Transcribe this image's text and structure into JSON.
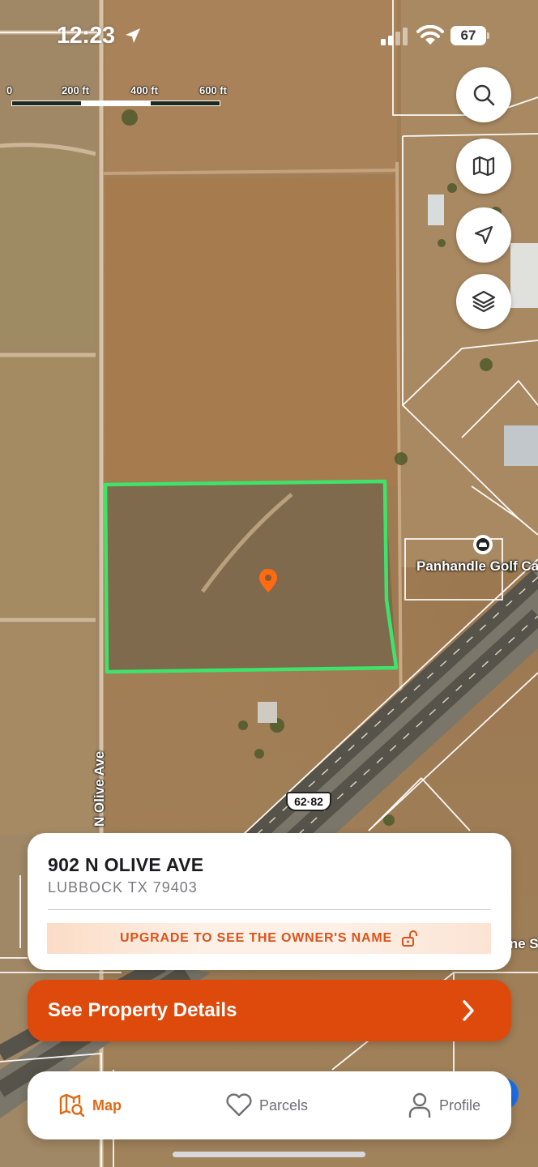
{
  "status_bar": {
    "time": "12:23",
    "battery": "67"
  },
  "scale": {
    "labels": [
      "0",
      "200 ft",
      "400 ft",
      "600 ft"
    ]
  },
  "map": {
    "road_label": "N Olive Ave",
    "poi_label": "Panhandle Golf Car",
    "highway_shield": "62·82",
    "edge_label": "ine S"
  },
  "map_controls": [
    {
      "name": "search",
      "icon": "search-icon"
    },
    {
      "name": "map",
      "icon": "map-icon"
    },
    {
      "name": "locate",
      "icon": "location-arrow-icon"
    },
    {
      "name": "layers",
      "icon": "layers-icon"
    }
  ],
  "property": {
    "address": "902 N OLIVE AVE",
    "city": "LUBBOCK TX 79403",
    "upgrade_text": "UPGRADE TO SEE THE OWNER'S NAME"
  },
  "cta": {
    "label": "See Property Details"
  },
  "tabs": [
    {
      "label": "Map",
      "icon": "map-search-icon",
      "active": true
    },
    {
      "label": "Parcels",
      "icon": "heart-icon",
      "active": false
    },
    {
      "label": "Profile",
      "icon": "person-icon",
      "active": false
    }
  ],
  "colors": {
    "accent": "#de4a0b",
    "tab_active": "#de6a14",
    "parcel_outline": "#3ee36a",
    "pin": "#ff6a13"
  }
}
